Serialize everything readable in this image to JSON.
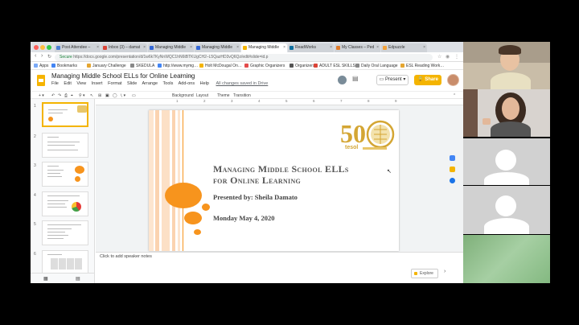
{
  "browser": {
    "tabs": [
      {
        "label": "Post Attendee –",
        "color": "#4a7fd4"
      },
      {
        "label": "Inbox (3) – damat",
        "color": "#db4437"
      },
      {
        "label": "Managing Middle",
        "color": "#3367d6"
      },
      {
        "label": "Managing Middle",
        "color": "#3367d6"
      },
      {
        "label": "Managing Middle",
        "color": "#f4b400"
      },
      {
        "label": "ReadWorks",
        "color": "#0c6e9e"
      },
      {
        "label": "My Classes – Ped",
        "color": "#e07b2a"
      },
      {
        "label": "Edpuzzle",
        "color": "#f2a23b"
      }
    ],
    "secure_label": "Secure",
    "url": "https://docs.google.com/presentation/d/1w6k7KyNnWQC1hN6tBTKUgCH2–L5QazHD3vQ6Qz/edit#slide=id.p",
    "bookmarks": [
      {
        "label": "Apps",
        "color": "#7baaf7"
      },
      {
        "label": "Bookmarks",
        "color": "#4285f4"
      },
      {
        "label": "January Challenge",
        "color": "#e5a631"
      },
      {
        "label": "SKEDULA",
        "color": "#888888"
      },
      {
        "label": "http://www.mymg…",
        "color": "#4285f4"
      },
      {
        "label": "Holt McDougal On…",
        "color": "#f4b400"
      },
      {
        "label": "Graphic Organizers",
        "color": "#e44c4c"
      },
      {
        "label": "Organizers",
        "color": "#555555"
      },
      {
        "label": "ADULT ESL SKILLS",
        "color": "#db4437"
      },
      {
        "label": "Daily Oral Language",
        "color": "#888888"
      },
      {
        "label": "ESL Reading Work…",
        "color": "#e5a631"
      }
    ]
  },
  "slides_app": {
    "doc_title": "Managing Middle School ELLs for Online Learning",
    "menu": [
      "File",
      "Edit",
      "View",
      "Insert",
      "Format",
      "Slide",
      "Arrange",
      "Tools",
      "Add-ons",
      "Help"
    ],
    "saved_status": "All changes saved in Drive",
    "present_label": "Present",
    "share_label": "Share",
    "toolbar": {
      "zoom_icon": "zoom-icon",
      "background": "Background",
      "layout": "Layout",
      "theme": "Theme",
      "transition": "Transition"
    },
    "ruler_numbers": [
      "1",
      "2",
      "3",
      "4",
      "5",
      "6",
      "7",
      "8",
      "9"
    ],
    "thumbnails": [
      "1",
      "2",
      "3",
      "4",
      "5",
      "6"
    ],
    "speaker_notes_placeholder": "Click to add speaker notes",
    "explore_label": "Explore"
  },
  "slide": {
    "title_line1": "Managing Middle School ELLs",
    "title_line2": "for Online Learning",
    "presenter": "Presented by: Sheila Damato",
    "date": "Monday May 4, 2020",
    "badge": {
      "number": "50",
      "org": "tesol",
      "color": "#d4a634"
    },
    "accent_color": "#f7941d"
  },
  "video_call": {
    "participants": [
      {
        "name": "participant-1",
        "type": "camera"
      },
      {
        "name": "participant-2",
        "type": "camera"
      },
      {
        "name": "participant-3",
        "type": "placeholder"
      },
      {
        "name": "participant-4",
        "type": "placeholder"
      },
      {
        "name": "participant-5",
        "type": "camera"
      }
    ]
  }
}
